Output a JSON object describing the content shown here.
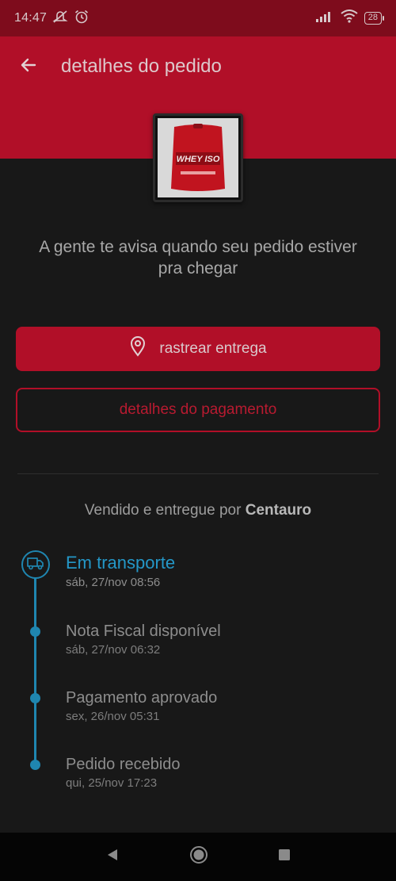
{
  "status_bar": {
    "time": "14:47",
    "battery": "28",
    "icons": [
      "mute-icon",
      "alarm-icon",
      "signal-icon",
      "wifi-icon",
      "battery-icon"
    ]
  },
  "app_bar": {
    "title": "detalhes do pedido",
    "back_icon": "arrow-left-icon"
  },
  "product": {
    "image_label": "WHEY ISO"
  },
  "notice": {
    "text": "A gente te avisa quando seu pedido estiver pra chegar"
  },
  "actions": {
    "track_label": "rastrear entrega",
    "payment_label": "detalhes do pagamento"
  },
  "seller": {
    "prefix": "Vendido e entregue por",
    "name": "Centauro"
  },
  "timeline": [
    {
      "name": "Em transporte",
      "date": "sáb, 27/nov 08:56"
    },
    {
      "name": "Nota Fiscal disponível",
      "date": "sáb, 27/nov 06:32"
    },
    {
      "name": "Pagamento aprovado",
      "date": "sex, 26/nov 05:31"
    },
    {
      "name": "Pedido recebido",
      "date": "qui, 25/nov 17:23"
    }
  ],
  "colors": {
    "brand_red": "#b10f28",
    "status_red": "#7e0c1c",
    "timeline_blue": "#1f86b0",
    "background": "#181818"
  }
}
